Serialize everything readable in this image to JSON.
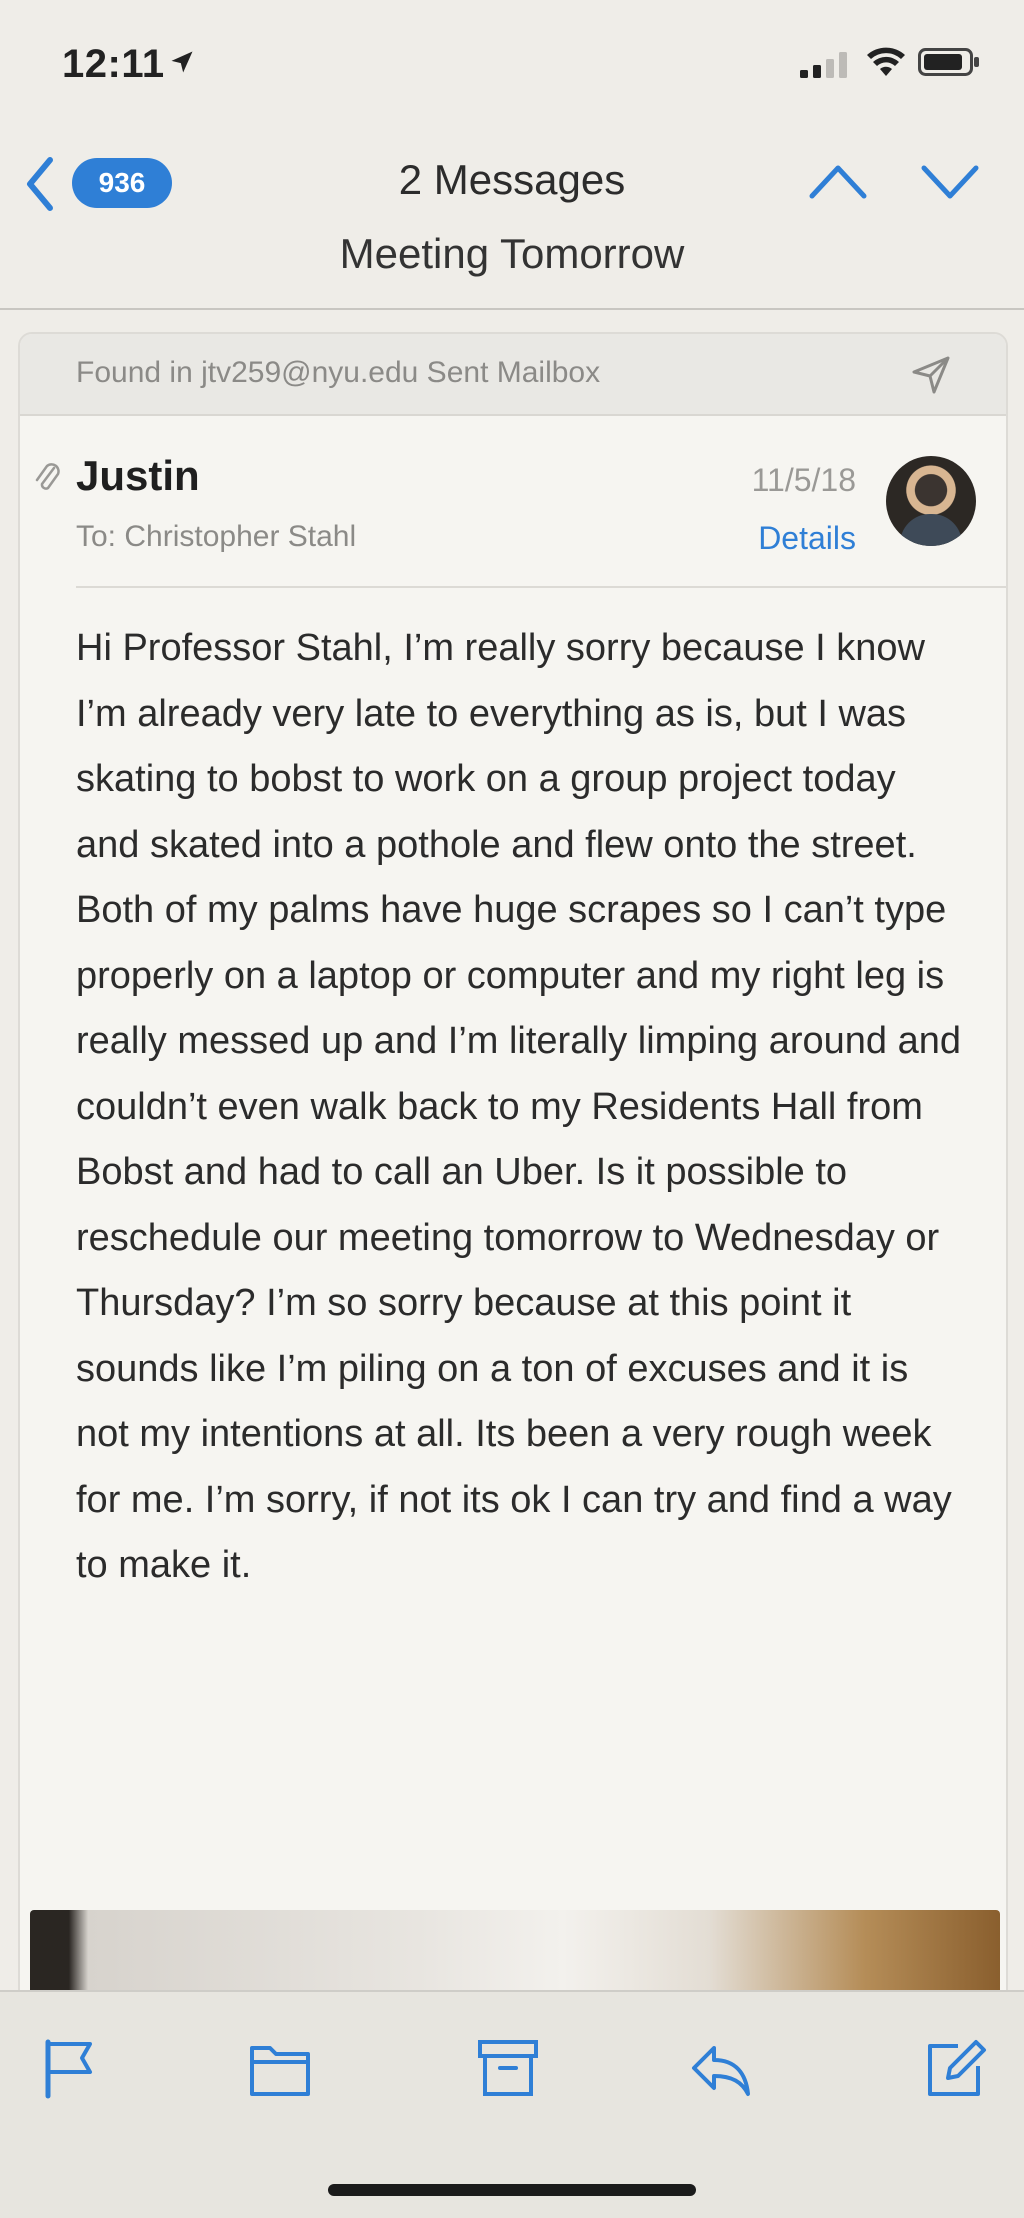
{
  "status_bar": {
    "time": "12:11",
    "icons": [
      "location-arrow-icon",
      "signal-icon",
      "wifi-icon",
      "battery-icon"
    ]
  },
  "nav": {
    "back_badge": "936",
    "message_count": "2 Messages",
    "subject": "Meeting Tomorrow",
    "icons": [
      "chevron-left-icon",
      "chevron-up-icon",
      "chevron-down-icon"
    ]
  },
  "message": {
    "found_in": "Found in jtv259@nyu.edu Sent Mailbox",
    "sender": "Justin",
    "to_label": "To:",
    "to_name": "Christopher Stahl",
    "date": "11/5/18",
    "details_label": "Details",
    "body": "Hi Professor Stahl, I’m really sorry because I know I’m already very late to everything as is, but I was skating to bobst to work on a group project today and skated into a pothole and flew onto the street. Both of my palms have huge scrapes so I can’t type properly on a laptop or computer and my right leg is really messed up and I’m literally limping around and couldn’t even walk back to my Residents Hall from Bobst and had to call an Uber. Is it possible to reschedule our meeting tomorrow to Wednesday or Thursday? I’m so sorry because at this point it sounds like I’m piling on a ton of excuses and it is not my intentions at all. Its been a very rough week for me. I’m sorry, if not its ok I can try and find a way to make it."
  },
  "toolbar": {
    "icons": [
      "flag-icon",
      "folder-icon",
      "archive-icon",
      "reply-icon",
      "compose-icon"
    ]
  },
  "colors": {
    "accent": "#2f7fd6",
    "background": "#efede8",
    "card": "#f6f5f1"
  }
}
